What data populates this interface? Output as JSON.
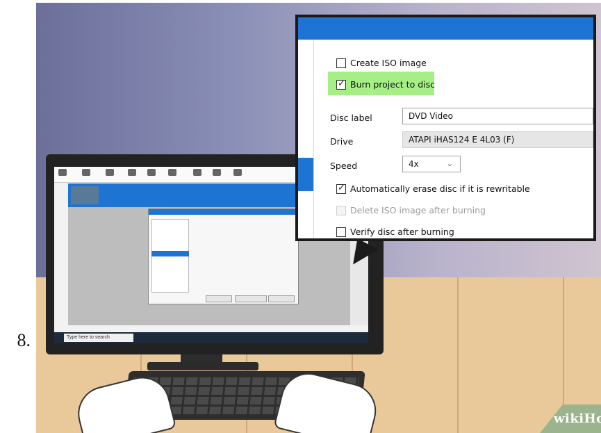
{
  "step_number": "8.",
  "zoom_panel": {
    "create_iso": {
      "label": "Create ISO image",
      "checked": false
    },
    "burn_project": {
      "label": "Burn project to disc",
      "checked": true,
      "highlight_color": "#a6ef86"
    },
    "disc_label": {
      "label": "Disc label",
      "value": "DVD Video"
    },
    "drive": {
      "label": "Drive",
      "value": "ATAPI iHAS124   E 4L03 (F)"
    },
    "speed": {
      "label": "Speed",
      "value": "4x"
    },
    "auto_erase": {
      "label": "Automatically erase disc if it is rewritable",
      "checked": true
    },
    "delete_iso": {
      "label": "Delete ISO image after burning",
      "checked": false,
      "disabled": true
    },
    "verify": {
      "label": "Verify disc after burning",
      "checked": false
    }
  },
  "taskbar": {
    "search_placeholder": "Type here to search"
  },
  "watermark": {
    "wiki": "wiki",
    "how": "How"
  },
  "colors": {
    "accent": "#1e74d2",
    "highlight": "#a6ef86"
  }
}
